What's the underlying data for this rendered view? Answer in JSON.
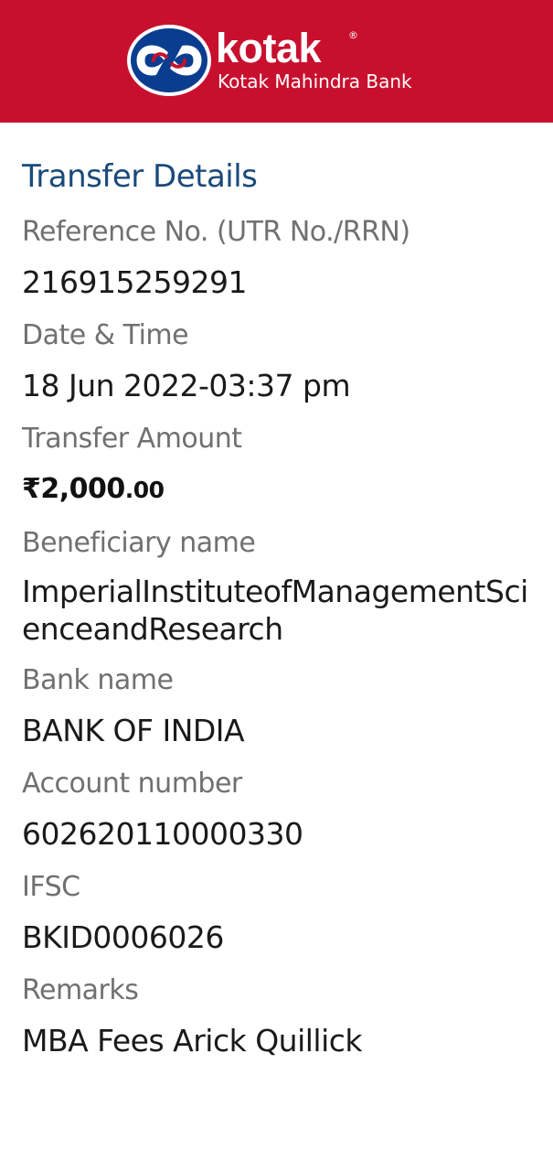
{
  "brand": {
    "name": "kotak",
    "registered": "®",
    "subtitle": "Kotak Mahindra Bank",
    "colors": {
      "header_bg": "#c8102e",
      "logo_circle": "#0a3d8f",
      "accent_text": "#1a4a7a"
    },
    "logo_icon": "kotak-infinity-logo-icon"
  },
  "transfer": {
    "title": "Transfer Details",
    "reference_label": "Reference No. (UTR No./RRN)",
    "reference_value": "216915259291",
    "datetime_label": "Date & Time",
    "datetime_value": "18 Jun 2022-03:37 pm",
    "amount_label": "Transfer Amount",
    "amount_main": "₹2,000",
    "amount_paise": ".00",
    "beneficiary_label": "Beneficiary name",
    "beneficiary_value": "ImperialInstituteofManagementScienceandResearch",
    "bank_label": "Bank name",
    "bank_value": "BANK OF INDIA",
    "account_label": "Account number",
    "account_value": "602620110000330",
    "ifsc_label": "IFSC",
    "ifsc_value": "BKID0006026",
    "remarks_label": "Remarks",
    "remarks_value": "MBA Fees Arick Quillick"
  }
}
